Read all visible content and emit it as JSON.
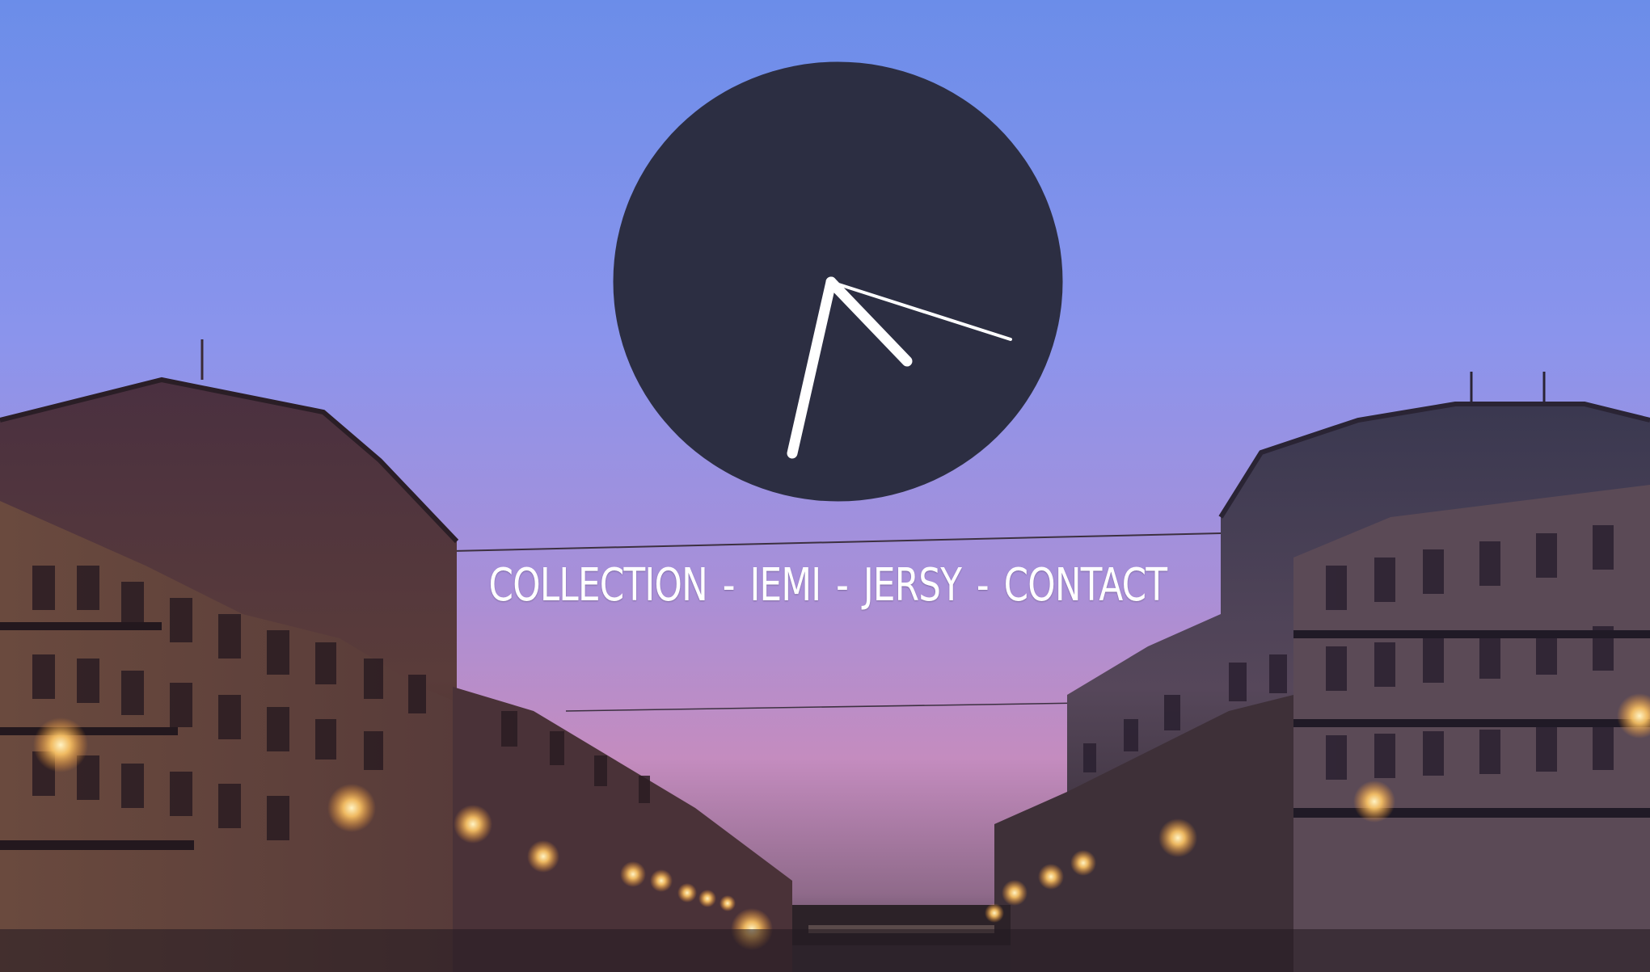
{
  "hero": {
    "background_description": "dusk-canal-street-scene",
    "sky_top_color": "#6d8ce8",
    "sky_mid_color": "#9a8fe0",
    "sky_horizon_color": "#c88ab8",
    "clock_face_color": "#2c2e42",
    "clock_hand_color": "#ffffff"
  },
  "nav": {
    "items": [
      {
        "label": "COLLECTION"
      },
      {
        "label": "IEMI"
      },
      {
        "label": "JERSY"
      },
      {
        "label": "CONTACT"
      }
    ],
    "separator": "-"
  }
}
